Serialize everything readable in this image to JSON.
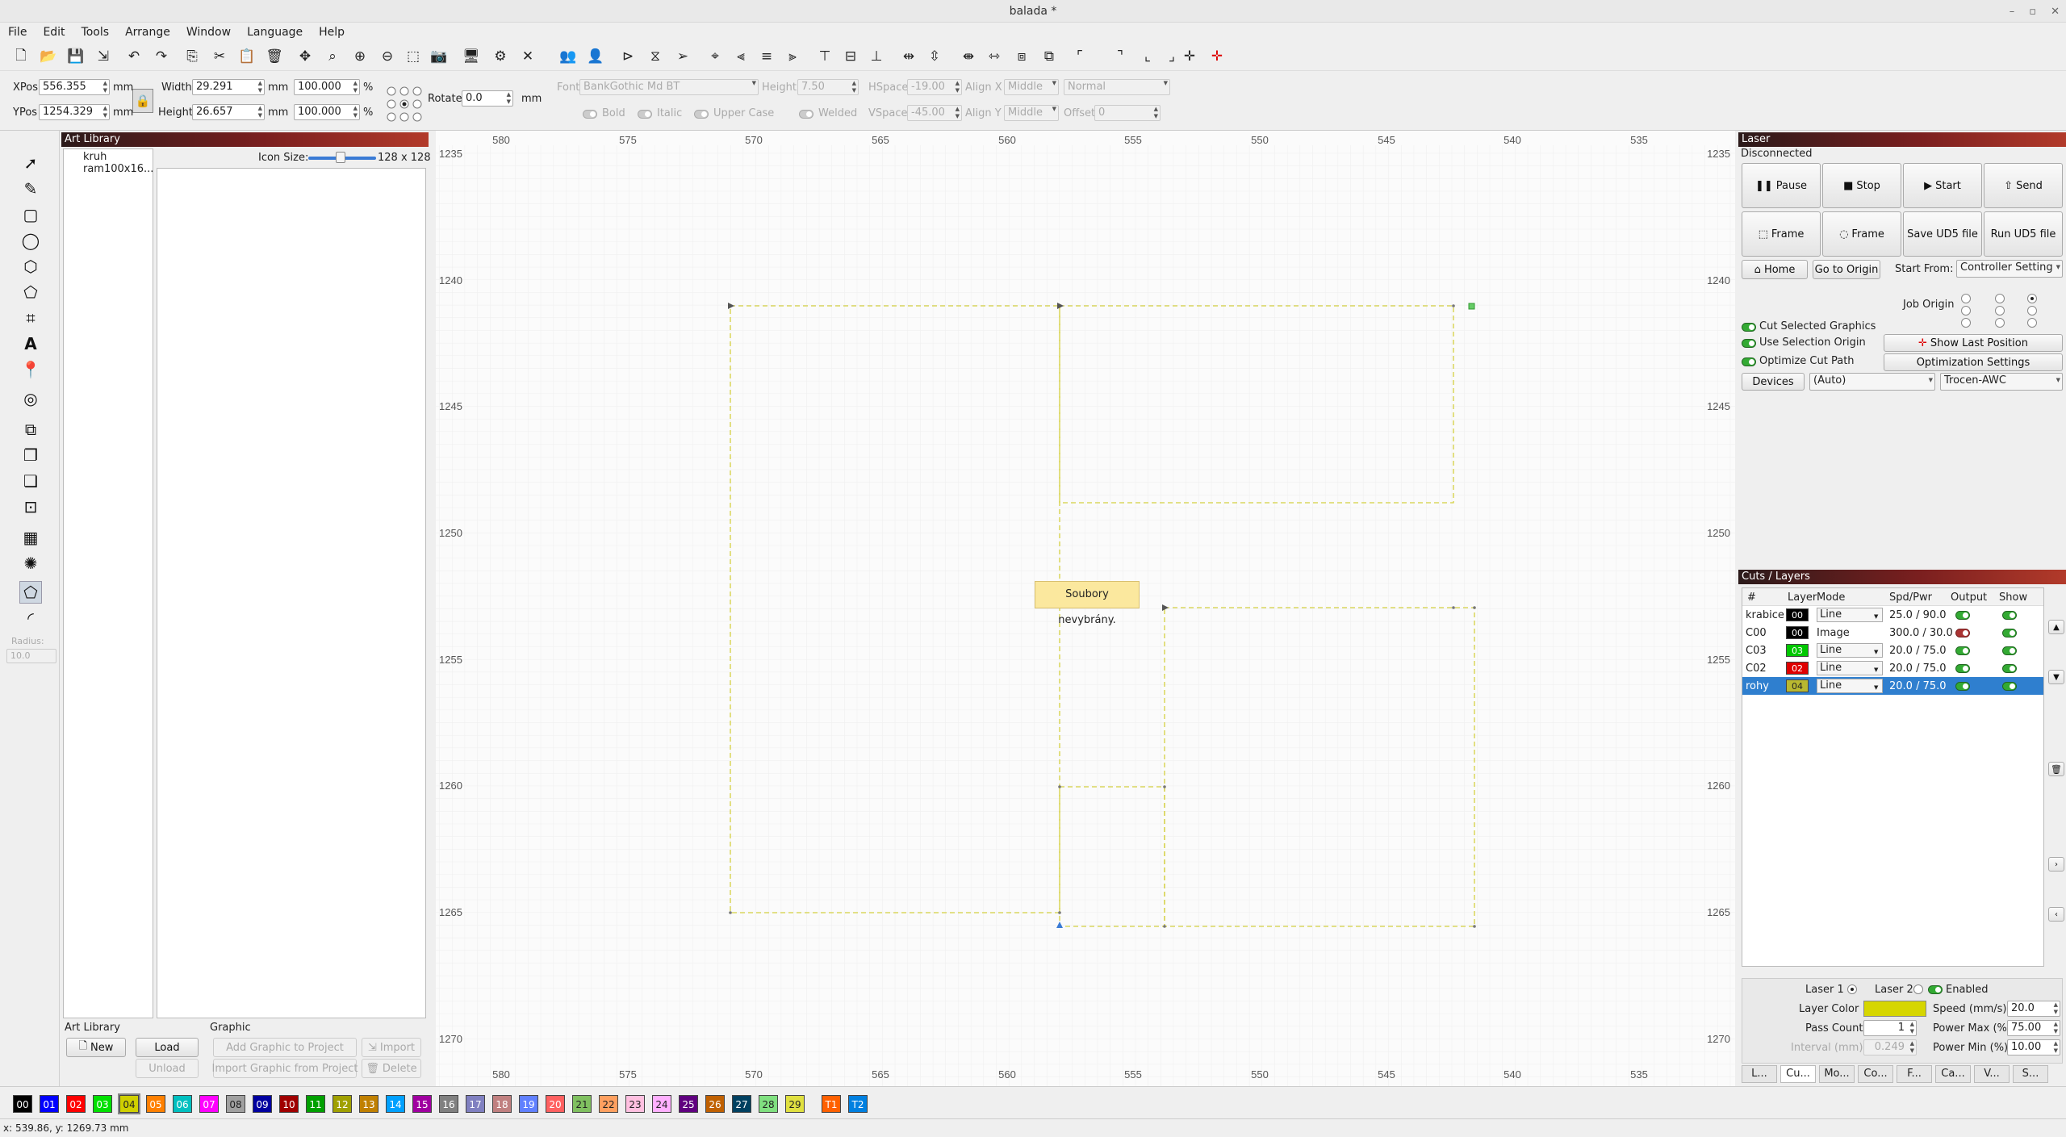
{
  "window": {
    "title": "balada *"
  },
  "menu": [
    "File",
    "Edit",
    "Tools",
    "Arrange",
    "Window",
    "Language",
    "Help"
  ],
  "props": {
    "xpos_label": "XPos",
    "xpos": "556.355",
    "ypos_label": "YPos",
    "ypos": "1254.329",
    "unit": "mm",
    "width_label": "Width",
    "width": "29.291",
    "width_pct": "100.000",
    "height_label": "Height",
    "height": "26.657",
    "height_pct": "100.000",
    "pct": "%",
    "rotate_label": "Rotate",
    "rotate": "0.0",
    "font_label": "Font",
    "font": "BankGothic Md BT",
    "fheight_label": "Height",
    "fheight": "7.50",
    "hspace_label": "HSpace",
    "hspace": "-19.00",
    "vspace_label": "VSpace",
    "vspace": "-45.00",
    "alignx_label": "Align X",
    "alignx": "Middle",
    "aligny_label": "Align Y",
    "aligny": "Middle",
    "normal": "Normal",
    "offset_label": "Offset",
    "offset": "0",
    "bold": "Bold",
    "italic": "Italic",
    "upper": "Upper Case",
    "welded": "Welded"
  },
  "radius": {
    "label": "Radius:",
    "value": "10.0"
  },
  "artlib": {
    "title": "Art Library",
    "items": [
      "kruh",
      "ram100x16..."
    ],
    "icon_size_label": "Icon Size:",
    "icon_size_value": "128 x 128",
    "lib_label": "Art Library",
    "graphic_label": "Graphic",
    "new": "New",
    "load": "Load",
    "unload": "Unload",
    "add": "Add Graphic to Project",
    "import_from": "Import Graphic from Project",
    "import": "Import",
    "delete": "Delete"
  },
  "rulers": {
    "x": [
      "580",
      "575",
      "570",
      "565",
      "560",
      "555",
      "550",
      "545",
      "540",
      "535"
    ],
    "y": [
      "1235",
      "1240",
      "1245",
      "1250",
      "1255",
      "1260",
      "1265",
      "1270"
    ]
  },
  "tooltip": "Soubory nevybrány.",
  "laser": {
    "title": "Laser",
    "status": "Disconnected",
    "pause": "Pause",
    "stop": "Stop",
    "start": "Start",
    "send": "Send",
    "frame1": "Frame",
    "frame2": "Frame",
    "save_ud5": "Save UD5 file",
    "run_ud5": "Run UD5 file",
    "home": "Home",
    "goto_origin": "Go to Origin",
    "start_from_label": "Start From:",
    "start_from": "Controller Setting",
    "job_origin": "Job Origin",
    "cut_selected": "Cut Selected Graphics",
    "use_selection": "Use Selection Origin",
    "optimize": "Optimize Cut Path",
    "show_last": "Show Last Position",
    "opt_settings": "Optimization Settings",
    "devices": "Devices",
    "auto": "(Auto)",
    "device": "Trocen-AWC"
  },
  "cuts": {
    "title": "Cuts / Layers",
    "headers": [
      "#",
      "Layer",
      "Mode",
      "Spd/Pwr",
      "Output",
      "Show"
    ],
    "rows": [
      {
        "name": "krabice",
        "layer": "00",
        "color": "#000000",
        "mode": "Line",
        "spd": "25.0 / 90.0"
      },
      {
        "name": "C00",
        "layer": "00",
        "color": "#000000",
        "mode": "Image",
        "spd": "300.0 / 30.0"
      },
      {
        "name": "C03",
        "layer": "03",
        "color": "#00c800",
        "mode": "Line",
        "spd": "20.0 / 75.0"
      },
      {
        "name": "C02",
        "layer": "02",
        "color": "#e00000",
        "mode": "Line",
        "spd": "20.0 / 75.0"
      },
      {
        "name": "rohy",
        "layer": "04",
        "color": "#c8c800",
        "mode": "Line",
        "spd": "20.0 / 75.0"
      }
    ],
    "laser1": "Laser 1",
    "laser2": "Laser 2",
    "enabled": "Enabled",
    "layer_color": "Layer Color",
    "speed_label": "Speed (mm/s)",
    "speed": "20.0",
    "pass_label": "Pass Count",
    "pass": "1",
    "pmax_label": "Power Max (%)",
    "pmax": "75.00",
    "interval_label": "Interval (mm)",
    "interval": "0.249",
    "pmin_label": "Power Min (%)",
    "pmin": "10.00",
    "tabs": [
      "L...",
      "Cu...",
      "Mo...",
      "Co...",
      "F...",
      "Ca...",
      "V...",
      "S..."
    ]
  },
  "palette": [
    {
      "l": "00",
      "c": "#000000"
    },
    {
      "l": "01",
      "c": "#0000ff"
    },
    {
      "l": "02",
      "c": "#ff0000"
    },
    {
      "l": "03",
      "c": "#00e000"
    },
    {
      "l": "04",
      "c": "#d0d000"
    },
    {
      "l": "05",
      "c": "#ff8000"
    },
    {
      "l": "06",
      "c": "#00c0c0"
    },
    {
      "l": "07",
      "c": "#ff00ff"
    },
    {
      "l": "08",
      "c": "#a0a0a0"
    },
    {
      "l": "09",
      "c": "#0000a0"
    },
    {
      "l": "10",
      "c": "#a00000"
    },
    {
      "l": "11",
      "c": "#00a000"
    },
    {
      "l": "12",
      "c": "#a0a000"
    },
    {
      "l": "13",
      "c": "#c08000"
    },
    {
      "l": "14",
      "c": "#00a0ff"
    },
    {
      "l": "15",
      "c": "#a000a0"
    },
    {
      "l": "16",
      "c": "#808080"
    },
    {
      "l": "17",
      "c": "#8080c0"
    },
    {
      "l": "18",
      "c": "#c08080"
    },
    {
      "l": "19",
      "c": "#6080ff"
    },
    {
      "l": "20",
      "c": "#ff6060"
    },
    {
      "l": "21",
      "c": "#80c060"
    },
    {
      "l": "22",
      "c": "#ffa060"
    },
    {
      "l": "23",
      "c": "#ffc0e0"
    },
    {
      "l": "24",
      "c": "#ffb0ff"
    },
    {
      "l": "25",
      "c": "#600080"
    },
    {
      "l": "26",
      "c": "#c06000"
    },
    {
      "l": "27",
      "c": "#004060"
    },
    {
      "l": "28",
      "c": "#80e080"
    },
    {
      "l": "29",
      "c": "#e0e040"
    },
    {
      "l": "T1",
      "c": "#ff6000"
    },
    {
      "l": "T2",
      "c": "#0080e0"
    }
  ],
  "status": "x: 539.86, y: 1269.73 mm"
}
